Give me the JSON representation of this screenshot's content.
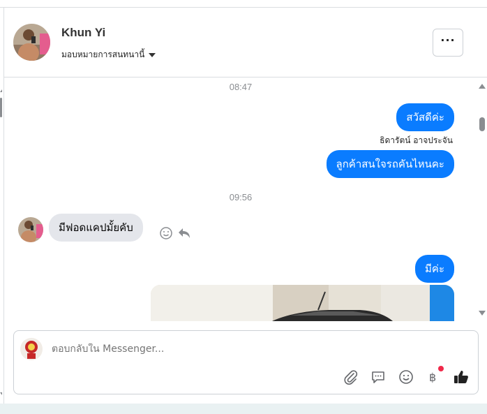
{
  "header": {
    "contact_name": "Khun Yi",
    "assign_label": "มอบหมายการสนทนานี้",
    "more_label": "···"
  },
  "messages": {
    "time1": "08:47",
    "out1": "สวัสดีค่ะ",
    "sender1": "ธิดารัตน์ อาจประจัน",
    "out2": "ลูกค้าสนใจรถคันไหนคะ",
    "time2": "09:56",
    "in1": "มีฟอดแคปมั้ยคับ",
    "out3": "มีค่ะ"
  },
  "composer": {
    "placeholder": "ตอบกลับใน Messenger..."
  },
  "icons": {
    "more": "more-dots-icon",
    "react": "smiley-icon",
    "reply": "reply-icon",
    "attach": "paperclip-icon",
    "chat": "speech-bubble-icon",
    "emoji": "smiley-icon",
    "baht": "baht-icon",
    "like": "thumbs-up-icon"
  },
  "colors": {
    "accent": "#0a7cff",
    "incoming_bubble": "#e4e6eb",
    "badge": "#f02849"
  }
}
